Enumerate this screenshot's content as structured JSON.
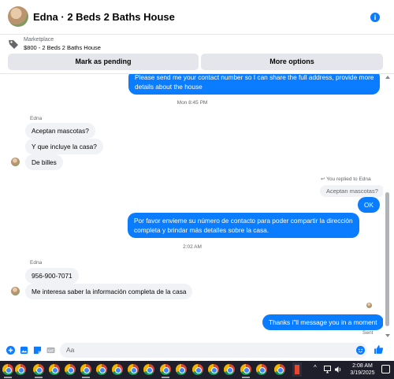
{
  "header": {
    "title": "Edna · 2 Beds 2 Baths House",
    "info_icon": "info-icon"
  },
  "marketplace": {
    "label": "Marketplace",
    "listing": "$800 - 2 Beds 2 Baths House",
    "mark_pending": "Mark as pending",
    "more_options": "More options"
  },
  "messages": {
    "out_first_line1": "Please send me your contact number so I can share the full address, provide more",
    "out_first_line2": "details about the house",
    "time1": "Mon 8:45 PM",
    "sender1": "Edna",
    "in1": "Aceptan mascotas?",
    "in2": "Y que incluye la casa?",
    "in3": "De billes",
    "replied_to": "You replied to Edna",
    "quoted": "Aceptan mascotas?",
    "out_ok": "OK",
    "out_long_line1": "Por favor envieme su número de contacto para poder compartir la dirección",
    "out_long_line2": "completa y brindar más detalles sobre la casa.",
    "time2": "2:02 AM",
    "sender2": "Edna",
    "in_phone": "956-900-7071",
    "in_info": "Me interesa saber la información completa de la casa",
    "out_last": "Thanks i\"ll message you in a moment",
    "sent": "Sent"
  },
  "composer": {
    "placeholder": "Aa"
  },
  "taskbar": {
    "time": "2:08 AM",
    "date": "3/19/2025"
  },
  "colors": {
    "accent": "#0a7cff",
    "incoming_bubble": "#f0f2f5",
    "taskbar": "#1f1f2b"
  }
}
